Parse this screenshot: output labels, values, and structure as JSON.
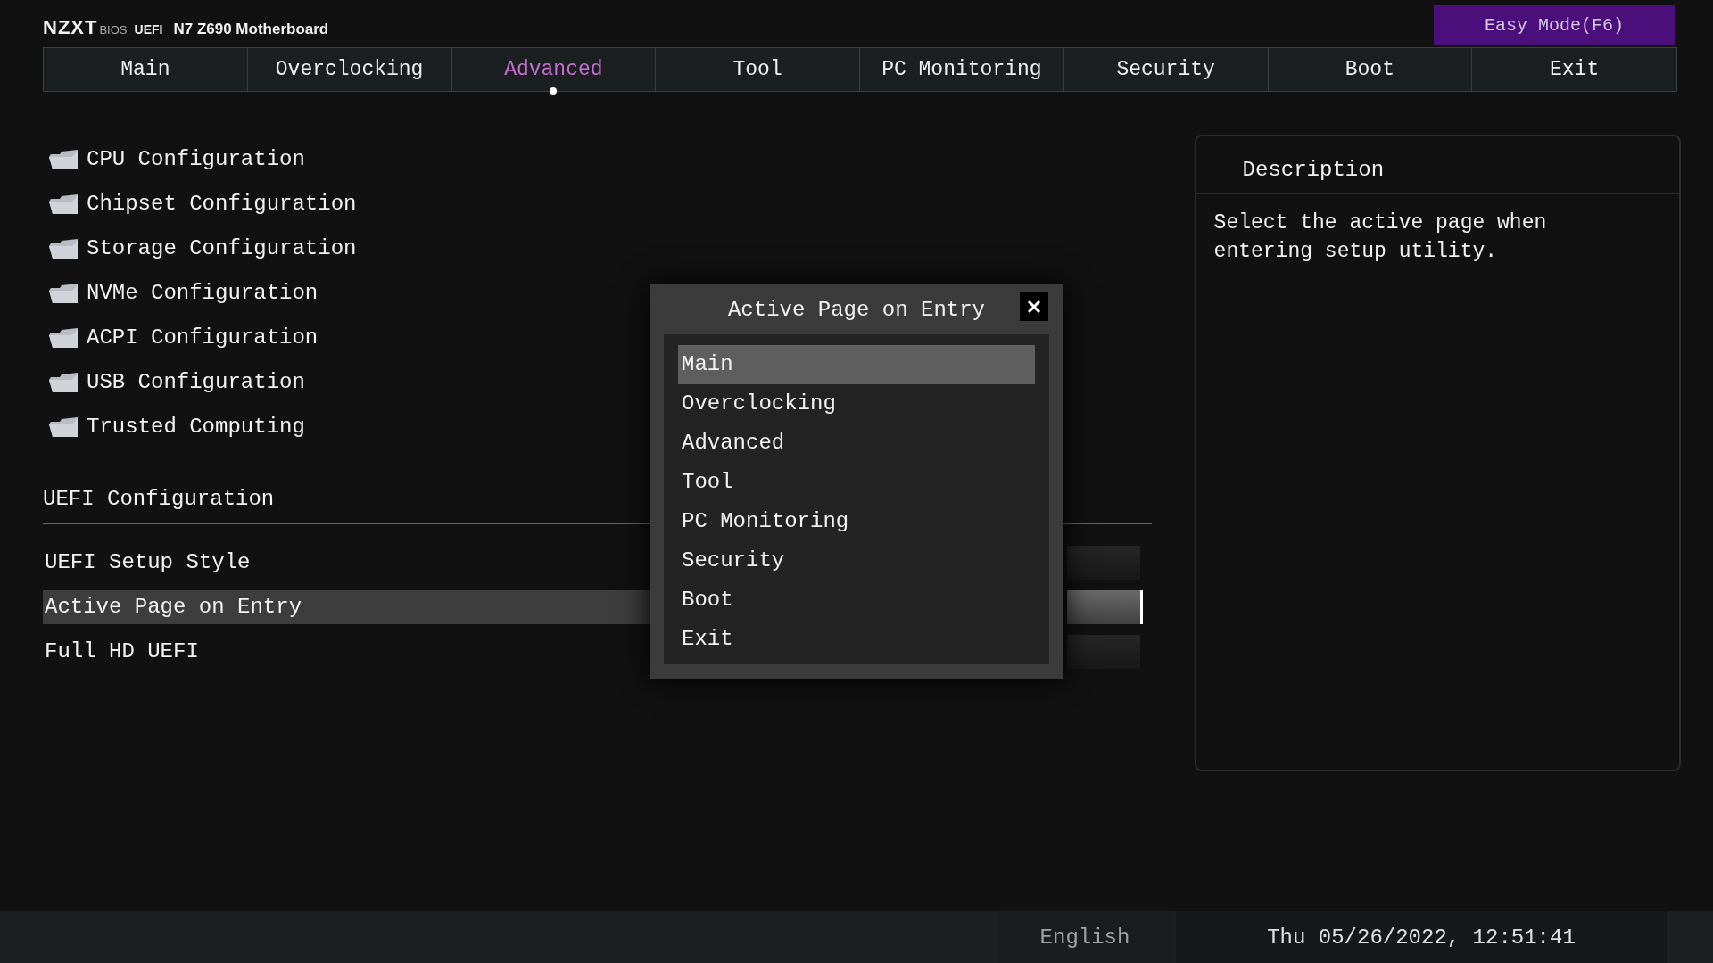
{
  "header": {
    "brand": "NZXT",
    "brand_sub": "BIOS",
    "firmware": "UEFI",
    "board": "N7 Z690 Motherboard",
    "mode_button": "Easy Mode(F6)"
  },
  "tabs": [
    {
      "label": "Main",
      "selected": false
    },
    {
      "label": "Overclocking",
      "selected": false
    },
    {
      "label": "Advanced",
      "selected": true
    },
    {
      "label": "Tool",
      "selected": false
    },
    {
      "label": "PC Monitoring",
      "selected": false
    },
    {
      "label": "Security",
      "selected": false
    },
    {
      "label": "Boot",
      "selected": false
    },
    {
      "label": "Exit",
      "selected": false
    }
  ],
  "submenus": [
    "CPU Configuration",
    "Chipset Configuration",
    "Storage Configuration",
    "NVMe Configuration",
    "ACPI Configuration",
    "USB Configuration",
    "Trusted Computing"
  ],
  "section_title": "UEFI Configuration",
  "settings": [
    {
      "label": "UEFI Setup Style",
      "selected": false
    },
    {
      "label": "Active Page on Entry",
      "selected": true
    },
    {
      "label": "Full HD UEFI",
      "selected": false
    }
  ],
  "description": {
    "title": "Description",
    "text": "Select the active page when entering setup utility."
  },
  "dialog": {
    "title": "Active Page on Entry",
    "options": [
      {
        "label": "Main",
        "selected": true
      },
      {
        "label": "Overclocking",
        "selected": false
      },
      {
        "label": "Advanced",
        "selected": false
      },
      {
        "label": "Tool",
        "selected": false
      },
      {
        "label": "PC Monitoring",
        "selected": false
      },
      {
        "label": "Security",
        "selected": false
      },
      {
        "label": "Boot",
        "selected": false
      },
      {
        "label": "Exit",
        "selected": false
      }
    ]
  },
  "status_bar": {
    "language": "English",
    "datetime": "Thu 05/26/2022, 12:51:41"
  }
}
